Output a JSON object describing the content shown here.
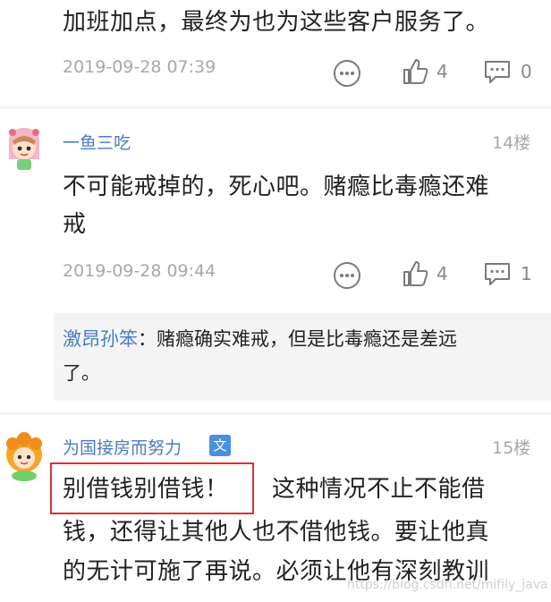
{
  "comments": [
    {
      "text": "加班加点，最终为也为这些客户服务了。",
      "timestamp": "2019-09-28 07:39",
      "likes": "4",
      "replies": "0"
    },
    {
      "username": "一鱼三吃",
      "floor": "14楼",
      "text_line1": "不可能戒掉的，死心吧。赌瘾比毒瘾还难",
      "text_line2": "戒",
      "timestamp": "2019-09-28 09:44",
      "likes": "4",
      "replies": "1",
      "reply": {
        "user": "激昂孙笨",
        "separator": "：",
        "text_line1": "赌瘾确实难戒，但是比毒瘾还是差远",
        "text_line2": "了。"
      }
    },
    {
      "username": "为国接房而努力",
      "badge": "文",
      "floor": "15楼",
      "text_highlight": "别借钱别借钱！",
      "text_line1_rest": "这种情况不止不能借",
      "text_line2": "钱，还得让其他人也不借他钱。要让他真",
      "text_line3": "的无计可施了再说。必须让他有深刻教训"
    }
  ],
  "watermark": "https://blog.csdn.net/mifily_java",
  "colors": {
    "link": "#4a7cc0",
    "highlight_border": "#e0302e",
    "badge": "#4a90e2"
  },
  "icons": [
    "more-icon",
    "thumbs-up-icon",
    "comment-icon"
  ]
}
